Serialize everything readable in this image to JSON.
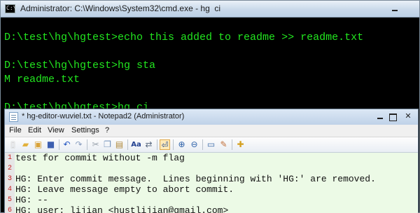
{
  "cmd": {
    "icon_label": "C:\\",
    "title": "Administrator: C:\\Windows\\System32\\cmd.exe - hg  ci",
    "lines": [
      "D:\\test\\hg\\hgtest>echo this added to readme >> readme.txt",
      "",
      "D:\\test\\hg\\hgtest>hg sta",
      "M readme.txt",
      "",
      "D:\\test\\hg\\hgtest>hg ci"
    ]
  },
  "notepad": {
    "title": "* hg-editor-wuviel.txt - Notepad2 (Administrator)",
    "close_label": "✕",
    "menu": [
      "File",
      "Edit",
      "View",
      "Settings",
      "?"
    ],
    "line_numbers": [
      "1",
      "2",
      "3",
      "4",
      "5",
      "6"
    ],
    "lines": [
      "test for commit without -m flag",
      "",
      "HG: Enter commit message.  Lines beginning with 'HG:' are removed.",
      "HG: Leave message empty to abort commit.",
      "HG: --",
      "HG: user: lijian <hustlijian@gmail.com>"
    ]
  },
  "toolbar_icons": [
    "new-icon",
    "open-icon",
    "browse-icon",
    "save-icon",
    "undo-icon",
    "redo-icon",
    "cut-icon",
    "copy-icon",
    "paste-icon",
    "find-icon",
    "replace-icon",
    "word-wrap-icon",
    "zoom-in-icon",
    "zoom-out-icon",
    "view-icon",
    "settings-icon",
    "favorites-icon"
  ],
  "colors": {
    "console_text": "#22e61f",
    "console_bg": "#000000",
    "editor_bg": "#ecfae6",
    "line_number": "#c81e1e"
  }
}
